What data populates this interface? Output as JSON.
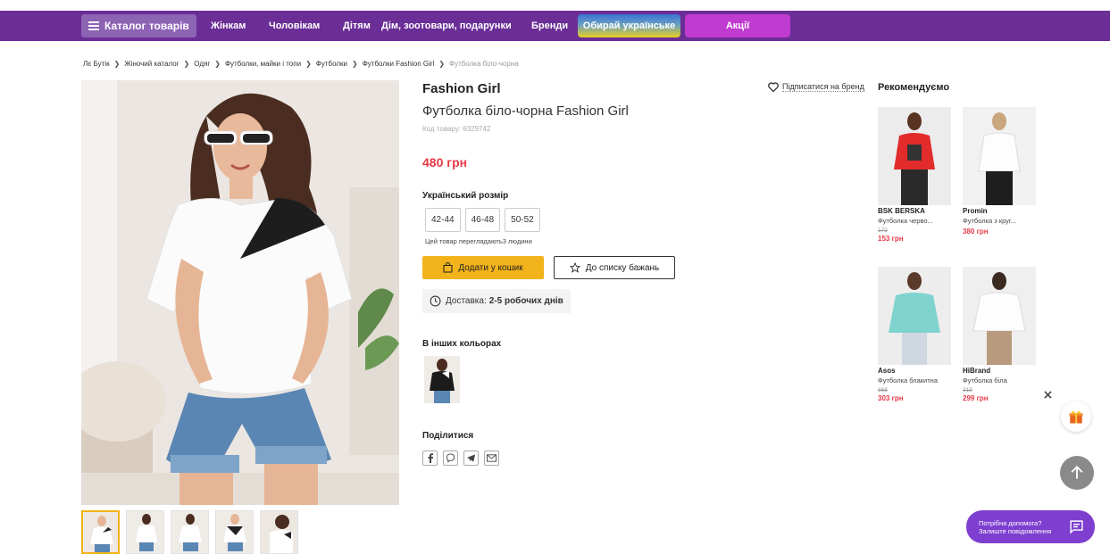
{
  "nav": {
    "catalog": "Каталог товарів",
    "links": [
      "Жінкам",
      "Чоловікам",
      "Дітям",
      "Дім, зоотовари, подарунки",
      "Бренди"
    ],
    "ukrainian": "Обирай українське",
    "sale": "Акції"
  },
  "breadcrumb": [
    "Лє Бутік",
    "Жіночий каталог",
    "Одяг",
    "Футболки, майки і топи",
    "Футболки",
    "Футболки Fashion Girl"
  ],
  "breadcrumb_current": "Футболка біло-чорна",
  "product": {
    "brand": "Fashion Girl",
    "name": "Футболка біло-чорна Fashion Girl",
    "sku": "Код товару: 6329742",
    "price": "480 грн",
    "follow": "Підписатися на бренд",
    "size_heading": "Український розмір",
    "sizes": [
      "42-44",
      "46-48",
      "50-52"
    ],
    "viewing": "Цей товар переглядають3 людини",
    "add_to_cart": "Додати у кошик",
    "wishlist": "До списку бажань",
    "delivery_label": "Доставка:",
    "delivery_value": "2-5 робочих днів",
    "colors_heading": "В інших кольорах",
    "share_heading": "Поділитися"
  },
  "recommend": {
    "heading": "Рекомендуємо",
    "items": [
      {
        "brand": "BSK BERSKA",
        "name": "Футболка черво...",
        "old": "172",
        "price": "153 грн"
      },
      {
        "brand": "Promin",
        "name": "Футболка з круг...",
        "old": "",
        "price": "380 грн"
      },
      {
        "brand": "Asos",
        "name": "Футболка блакитна",
        "old": "868",
        "price": "303 грн"
      },
      {
        "brand": "HiBrand",
        "name": "Футболка біла",
        "old": "319",
        "price": "299 грн"
      }
    ]
  },
  "help": {
    "line1": "Потрібна допомога?",
    "line2": "Залиште повідомлення"
  },
  "colors": {
    "nav": "#6b2d96",
    "accent": "#f2b31b",
    "price": "#e63946",
    "sale": "#c03bcf",
    "help": "#7e3fd0"
  }
}
